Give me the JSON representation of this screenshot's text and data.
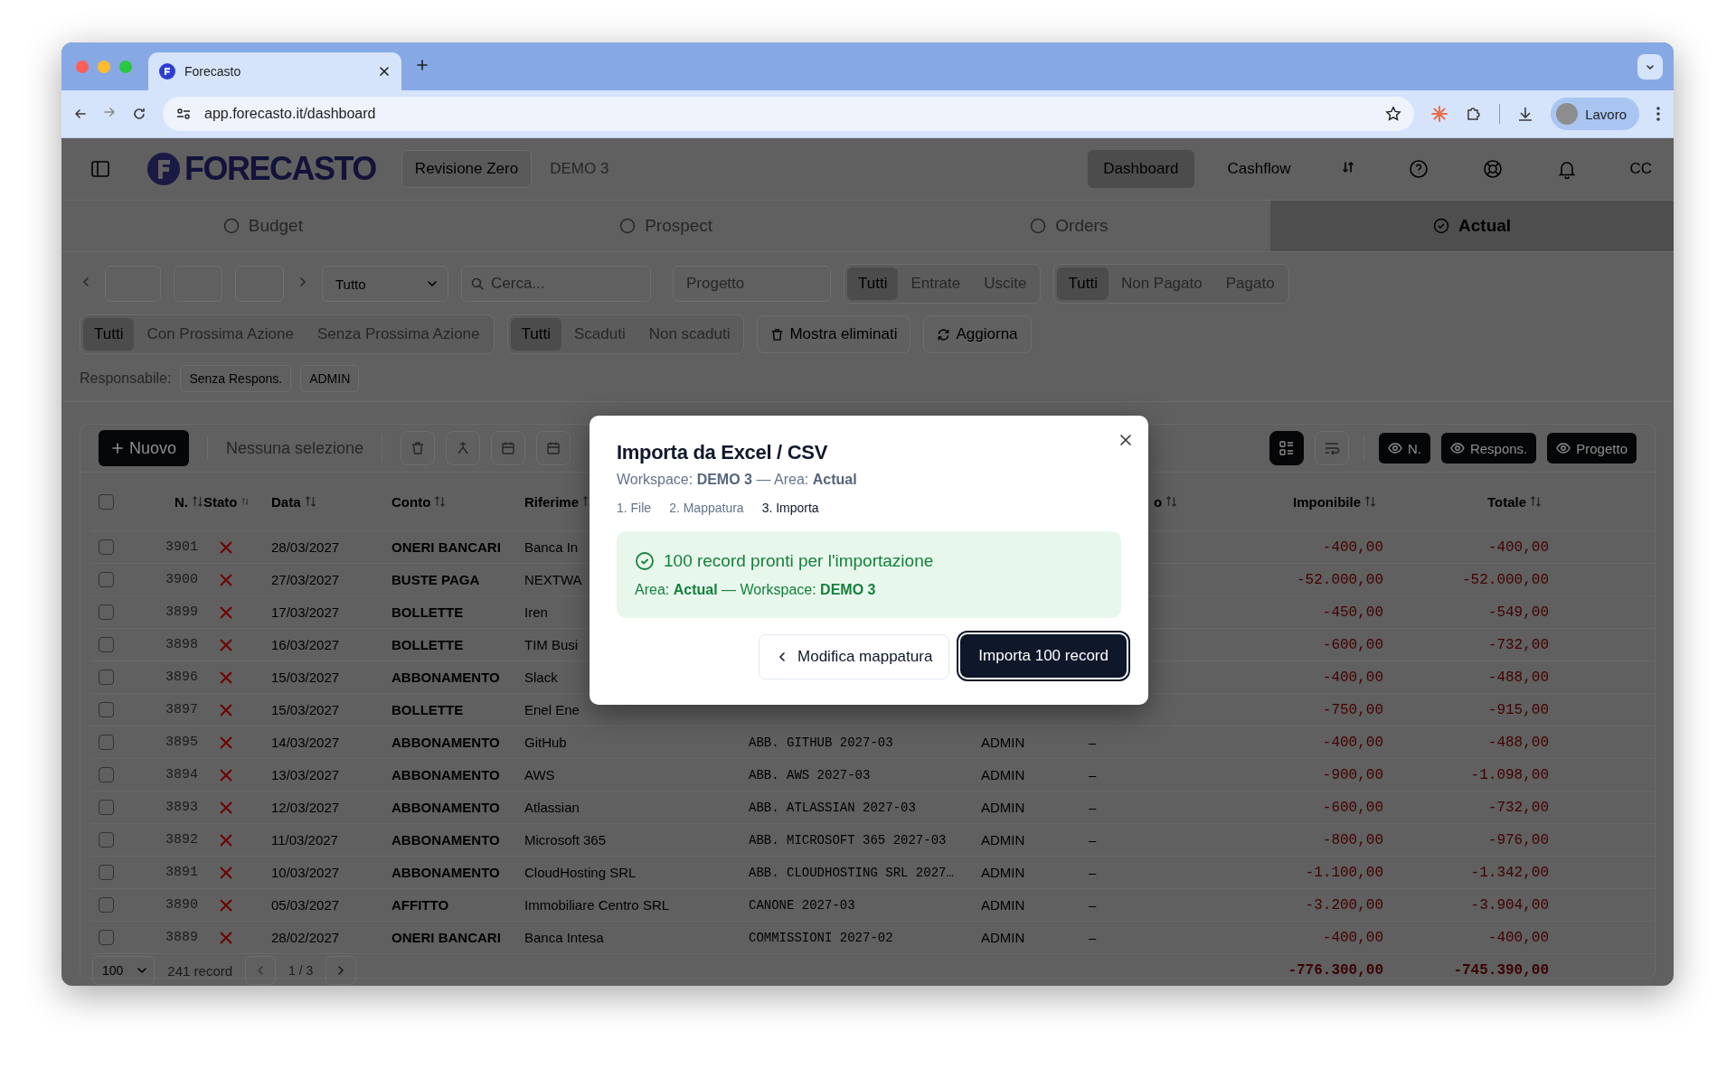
{
  "browser": {
    "tab_title": "Forecasto",
    "url": "app.forecasto.it/dashboard",
    "profile": "Lavoro"
  },
  "header": {
    "logo": "FORECASTO",
    "workspace_button": "Revisione Zero",
    "workspace_name": "DEMO 3",
    "nav": [
      {
        "label": "Dashboard",
        "selected": true
      },
      {
        "label": "Cashflow",
        "selected": false
      }
    ],
    "user_initials": "CC"
  },
  "area_tabs": [
    {
      "label": "Budget",
      "selected": false
    },
    {
      "label": "Prospect",
      "selected": false
    },
    {
      "label": "Orders",
      "selected": false
    },
    {
      "label": "Actual",
      "selected": true
    }
  ],
  "filters": {
    "type_select": "Tutto",
    "search_placeholder": "Cerca...",
    "project_placeholder": "Progetto",
    "row1_groups": [
      [
        {
          "label": "Tutti",
          "selected": true
        },
        {
          "label": "Entrate",
          "selected": false
        },
        {
          "label": "Uscite",
          "selected": false
        }
      ],
      [
        {
          "label": "Tutti",
          "selected": true
        },
        {
          "label": "Non Pagato",
          "selected": false
        },
        {
          "label": "Pagato",
          "selected": false
        }
      ]
    ],
    "row2_groups": [
      [
        {
          "label": "Tutti",
          "selected": true
        },
        {
          "label": "Con Prossima Azione",
          "selected": false
        },
        {
          "label": "Senza Prossima Azione",
          "selected": false
        }
      ],
      [
        {
          "label": "Tutti",
          "selected": true
        },
        {
          "label": "Scaduti",
          "selected": false
        },
        {
          "label": "Non scaduti",
          "selected": false
        }
      ]
    ],
    "show_deleted_button": "Mostra eliminati",
    "refresh_button": "Aggiorna",
    "owner_label": "Responsabile:",
    "owner_chips": [
      "Senza Respons.",
      "ADMIN"
    ]
  },
  "toolbar": {
    "new_button": "Nuovo",
    "selection": "Nessuna selezione",
    "view_modes": [
      {
        "kind": "list",
        "selected": true
      },
      {
        "kind": "wrap",
        "selected": false
      }
    ],
    "column_toggles": [
      "N.",
      "Respons.",
      "Progetto"
    ]
  },
  "table": {
    "all_selected": false,
    "columns": [
      {
        "label": "N."
      },
      {
        "label": "Stato"
      },
      {
        "label": "Data"
      },
      {
        "label": "Conto"
      },
      {
        "label": "Riferime"
      },
      {
        "label": "o"
      },
      {
        "label": "Imponibile"
      },
      {
        "label": "Totale"
      }
    ],
    "rows": [
      {
        "selected": false,
        "number": "3901",
        "paid": false,
        "date": "28/03/2027",
        "account": "ONERI BANCARI",
        "reference": "Banca In",
        "taxable": "-400,00",
        "total": "-400,00"
      },
      {
        "selected": false,
        "number": "3900",
        "paid": false,
        "date": "27/03/2027",
        "account": "BUSTE PAGA",
        "reference": "NEXTWA",
        "taxable": "-52.000,00",
        "total": "-52.000,00"
      },
      {
        "selected": false,
        "number": "3899",
        "paid": false,
        "date": "17/03/2027",
        "account": "BOLLETTE",
        "reference": "Iren",
        "taxable": "-450,00",
        "total": "-549,00"
      },
      {
        "selected": false,
        "number": "3898",
        "paid": false,
        "date": "16/03/2027",
        "account": "BOLLETTE",
        "reference": "TIM Busi",
        "taxable": "-600,00",
        "total": "-732,00"
      },
      {
        "selected": false,
        "number": "3896",
        "paid": false,
        "date": "15/03/2027",
        "account": "ABBONAMENTO",
        "reference": "Slack",
        "taxable": "-400,00",
        "total": "-488,00"
      },
      {
        "selected": false,
        "number": "3897",
        "paid": false,
        "date": "15/03/2027",
        "account": "BOLLETTE",
        "reference": "Enel Ene",
        "taxable": "-750,00",
        "total": "-915,00"
      },
      {
        "selected": false,
        "number": "3895",
        "paid": false,
        "date": "14/03/2027",
        "account": "ABBONAMENTO",
        "reference": "GitHub",
        "description": "ABB. GITHUB 2027-03",
        "owner": "ADMIN",
        "project": "–",
        "taxable": "-400,00",
        "total": "-488,00"
      },
      {
        "selected": false,
        "number": "3894",
        "paid": false,
        "date": "13/03/2027",
        "account": "ABBONAMENTO",
        "reference": "AWS",
        "description": "ABB. AWS 2027-03",
        "owner": "ADMIN",
        "project": "–",
        "taxable": "-900,00",
        "total": "-1.098,00"
      },
      {
        "selected": false,
        "number": "3893",
        "paid": false,
        "date": "12/03/2027",
        "account": "ABBONAMENTO",
        "reference": "Atlassian",
        "description": "ABB. ATLASSIAN 2027-03",
        "owner": "ADMIN",
        "project": "–",
        "taxable": "-600,00",
        "total": "-732,00"
      },
      {
        "selected": false,
        "number": "3892",
        "paid": false,
        "date": "11/03/2027",
        "account": "ABBONAMENTO",
        "reference": "Microsoft 365",
        "description": "ABB. MICROSOFT 365 2027-03",
        "owner": "ADMIN",
        "project": "–",
        "taxable": "-800,00",
        "total": "-976,00"
      },
      {
        "selected": false,
        "number": "3891",
        "paid": false,
        "date": "10/03/2027",
        "account": "ABBONAMENTO",
        "reference": "CloudHosting SRL",
        "description": "ABB. CLOUDHOSTING SRL 2027…",
        "owner": "ADMIN",
        "project": "–",
        "taxable": "-1.100,00",
        "total": "-1.342,00"
      },
      {
        "selected": false,
        "number": "3890",
        "paid": false,
        "date": "05/03/2027",
        "account": "AFFITTO",
        "reference": "Immobiliare Centro SRL",
        "description": "CANONE 2027-03",
        "owner": "ADMIN",
        "project": "–",
        "taxable": "-3.200,00",
        "total": "-3.904,00"
      },
      {
        "selected": false,
        "number": "3889",
        "paid": false,
        "date": "28/02/2027",
        "account": "ONERI BANCARI",
        "reference": "Banca Intesa",
        "description": "COMMISSIONI 2027-02",
        "owner": "ADMIN",
        "project": "–",
        "taxable": "-400,00",
        "total": "-400,00"
      }
    ],
    "footer": {
      "page_size": "100",
      "count": "241 record",
      "page": "1 / 3",
      "total_taxable": "-776.300,00",
      "total_total": "-745.390,00"
    }
  },
  "modal": {
    "title": "Importa da Excel / CSV",
    "subtitle": "Workspace: **DEMO 3** — Area: **Actual**",
    "steps": [
      {
        "label": "1. File",
        "selected": false
      },
      {
        "label": "2. Mappatura",
        "selected": false
      },
      {
        "label": "3. Importa",
        "selected": true
      }
    ],
    "success_title": "100 record pronti per l'importazione",
    "success_detail": "Area: **Actual** — Workspace: **DEMO 3**",
    "back_button": "Modifica mappatura",
    "primary_button": "Importa 100 record"
  }
}
